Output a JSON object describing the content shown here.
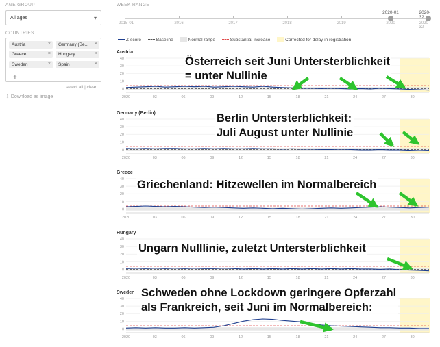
{
  "sidebar": {
    "age_group_label": "AGE GROUP",
    "age_group_value": "All ages",
    "countries_label": "COUNTRIES",
    "countries": [
      {
        "name": "Austria"
      },
      {
        "name": "Germany (Be..."
      },
      {
        "name": "Greece"
      },
      {
        "name": "Hungary"
      },
      {
        "name": "Sweden"
      },
      {
        "name": "Spain"
      }
    ],
    "remove_glyph": "×",
    "add_glyph": "+",
    "select_all": "select all",
    "separator": "|",
    "clear": "clear",
    "download": "Download as image"
  },
  "week_range": {
    "label": "WEEK RANGE",
    "years": [
      "2015-01",
      "2016",
      "2017",
      "2018",
      "2019",
      "2020",
      "2020-32"
    ],
    "start": "2020-01",
    "end": "2020-32"
  },
  "legend": {
    "zscore": "Z-score",
    "baseline": "Baseline",
    "normal": "Normal range",
    "substantial": "Substantial increase",
    "corrected": "Corrected for delay in registration"
  },
  "colors": {
    "zscore": "#1f3f8f",
    "baseline": "#555555",
    "normal": "#e6e6e6",
    "substantial": "#e04a4a",
    "corrected": "#fff6c8",
    "arrow": "#2ec42e"
  },
  "chart_data": [
    {
      "type": "line",
      "title": "Austria",
      "x_ticks": [
        "2020",
        "03",
        "06",
        "09",
        "12",
        "15",
        "18",
        "21",
        "24",
        "27",
        "30"
      ],
      "y_ticks": [
        0,
        10,
        20,
        30,
        40
      ],
      "ylim": [
        -5,
        40
      ],
      "baseline": 0,
      "substantial": 4,
      "series": [
        {
          "values": [
            1.5,
            2,
            2.5,
            3,
            2,
            2.5,
            3,
            2.5,
            3,
            2,
            2.5,
            3,
            2.5,
            2,
            3,
            2,
            1.5,
            1,
            0.5,
            0.5,
            0,
            0.5,
            0,
            -0.5,
            0,
            -0.5,
            0.5,
            0,
            -0.5,
            -1,
            -1.5,
            -2
          ]
        }
      ]
    },
    {
      "type": "line",
      "title": "Germany (Berlin)",
      "x_ticks": [
        "2020",
        "03",
        "06",
        "09",
        "12",
        "15",
        "18",
        "21",
        "24",
        "27",
        "30"
      ],
      "y_ticks": [
        0,
        10,
        20,
        30,
        40
      ],
      "ylim": [
        -5,
        40
      ],
      "baseline": 0,
      "substantial": 4,
      "series": [
        {
          "values": [
            1.5,
            1,
            1.5,
            1,
            1.5,
            1.5,
            1,
            1,
            1.5,
            1,
            1.5,
            1,
            1,
            1.5,
            1,
            1,
            0.5,
            1,
            0.5,
            0.5,
            0,
            0,
            0.5,
            0,
            -0.5,
            -0.5,
            0,
            -0.5,
            -0.5,
            -1,
            -1.5,
            -1
          ]
        }
      ]
    },
    {
      "type": "line",
      "title": "Greece",
      "x_ticks": [
        "2020",
        "03",
        "06",
        "09",
        "12",
        "15",
        "18",
        "21",
        "24",
        "27",
        "30"
      ],
      "y_ticks": [
        0,
        10,
        20,
        30,
        40
      ],
      "ylim": [
        -5,
        40
      ],
      "baseline": 0,
      "substantial": 4,
      "series": [
        {
          "values": [
            3,
            3.5,
            4,
            3.5,
            3,
            3.5,
            3,
            2.5,
            2,
            2.5,
            2,
            1.5,
            1,
            1.5,
            1,
            0.5,
            1,
            0.5,
            0,
            0.5,
            1,
            1.5,
            1,
            1.5,
            2,
            2.5,
            3,
            2.5,
            2,
            1.5,
            2,
            2.5
          ]
        }
      ]
    },
    {
      "type": "line",
      "title": "Hungary",
      "x_ticks": [
        "2020",
        "03",
        "06",
        "09",
        "12",
        "15",
        "18",
        "21",
        "24",
        "27",
        "30"
      ],
      "y_ticks": [
        0,
        10,
        20,
        30,
        40
      ],
      "ylim": [
        -5,
        40
      ],
      "baseline": 0,
      "substantial": 4,
      "series": [
        {
          "values": [
            1,
            1.5,
            1,
            1.5,
            1,
            1.5,
            1,
            1.5,
            1,
            1,
            1.5,
            1,
            0.5,
            1,
            0.5,
            1,
            0.5,
            1,
            0.5,
            1,
            0.5,
            1,
            0.5,
            1,
            0.5,
            0.5,
            0,
            0.5,
            -0.5,
            -1,
            -1.5,
            -2
          ]
        }
      ]
    },
    {
      "type": "line",
      "title": "Sweden",
      "x_ticks": [
        "2020",
        "03",
        "06",
        "09",
        "12",
        "15",
        "18",
        "21",
        "24",
        "27",
        "30"
      ],
      "y_ticks": [
        0,
        10,
        20,
        30,
        40
      ],
      "ylim": [
        -5,
        40
      ],
      "baseline": 0,
      "substantial": 4,
      "series": [
        {
          "values": [
            1,
            1.5,
            1,
            1.5,
            1,
            1,
            1.5,
            1,
            1.5,
            2,
            4,
            7,
            10,
            12,
            13,
            12.5,
            11,
            10,
            9,
            7,
            5,
            4,
            3.5,
            3,
            2.5,
            2,
            1.5,
            1.5,
            1,
            1,
            0.5,
            0.5
          ]
        }
      ]
    }
  ],
  "annotations": [
    {
      "line1": "Österreich seit Juni Untersterblichkeit",
      "line2": "= unter Nullinie"
    },
    {
      "line1": "Berlin Untersterblichkeit:",
      "line2": "Juli August unter Nullinie"
    },
    {
      "line1": "Griechenland: Hitzewellen im Normalbereich",
      "line2": ""
    },
    {
      "line1": "Ungarn Nulllinie, zuletzt Untersterblichkeit",
      "line2": ""
    },
    {
      "line1": "Schweden ohne Lockdown geringere Opferzahl",
      "line2": "als Frankreich, seit Juni im Normalbereich:"
    }
  ]
}
